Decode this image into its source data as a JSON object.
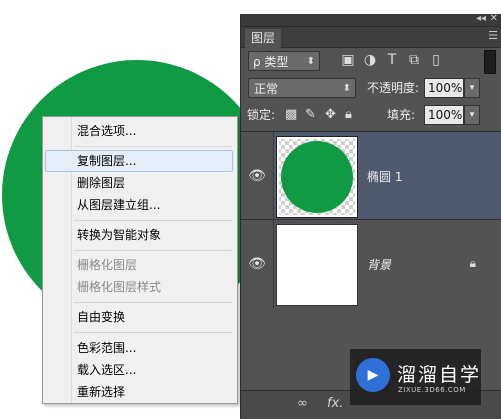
{
  "canvas": {
    "shape_color": "#0f9a43"
  },
  "layers_panel": {
    "tab_label": "图层",
    "filter": {
      "value": "ρ 类型",
      "icons": [
        "image-filter-icon",
        "adjustment-filter-icon",
        "text-filter-icon",
        "shape-filter-icon",
        "smart-object-filter-icon"
      ]
    },
    "blend_mode": "正常",
    "opacity_label": "不透明度:",
    "opacity_value": "100%",
    "lock_label": "锁定:",
    "fill_label": "填充:",
    "fill_value": "100%",
    "layers": [
      {
        "name": "椭圆 1",
        "selected": true,
        "visible": true
      },
      {
        "name": "背景",
        "selected": false,
        "visible": true,
        "locked": true
      }
    ],
    "bottom_icons": [
      "link-layers-icon",
      "fx-icon"
    ],
    "fx_label": "fx."
  },
  "context_menu": {
    "groups": [
      [
        {
          "label": "混合选项...",
          "enabled": true,
          "highlighted": false
        }
      ],
      [
        {
          "label": "复制图层...",
          "enabled": true,
          "highlighted": true
        },
        {
          "label": "删除图层",
          "enabled": true,
          "highlighted": false
        },
        {
          "label": "从图层建立组...",
          "enabled": true,
          "highlighted": false
        }
      ],
      [
        {
          "label": "转换为智能对象",
          "enabled": true,
          "highlighted": false
        }
      ],
      [
        {
          "label": "栅格化图层",
          "enabled": false,
          "highlighted": false
        },
        {
          "label": "栅格化图层样式",
          "enabled": false,
          "highlighted": false
        }
      ],
      [
        {
          "label": "自由变换",
          "enabled": true,
          "highlighted": false
        }
      ],
      [
        {
          "label": "色彩范围...",
          "enabled": true,
          "highlighted": false
        },
        {
          "label": "载入选区...",
          "enabled": true,
          "highlighted": false
        },
        {
          "label": "重新选择",
          "enabled": true,
          "highlighted": false
        }
      ]
    ]
  },
  "watermark": {
    "title": "溜溜自学",
    "url": "ZIXUE.3D66.COM"
  }
}
